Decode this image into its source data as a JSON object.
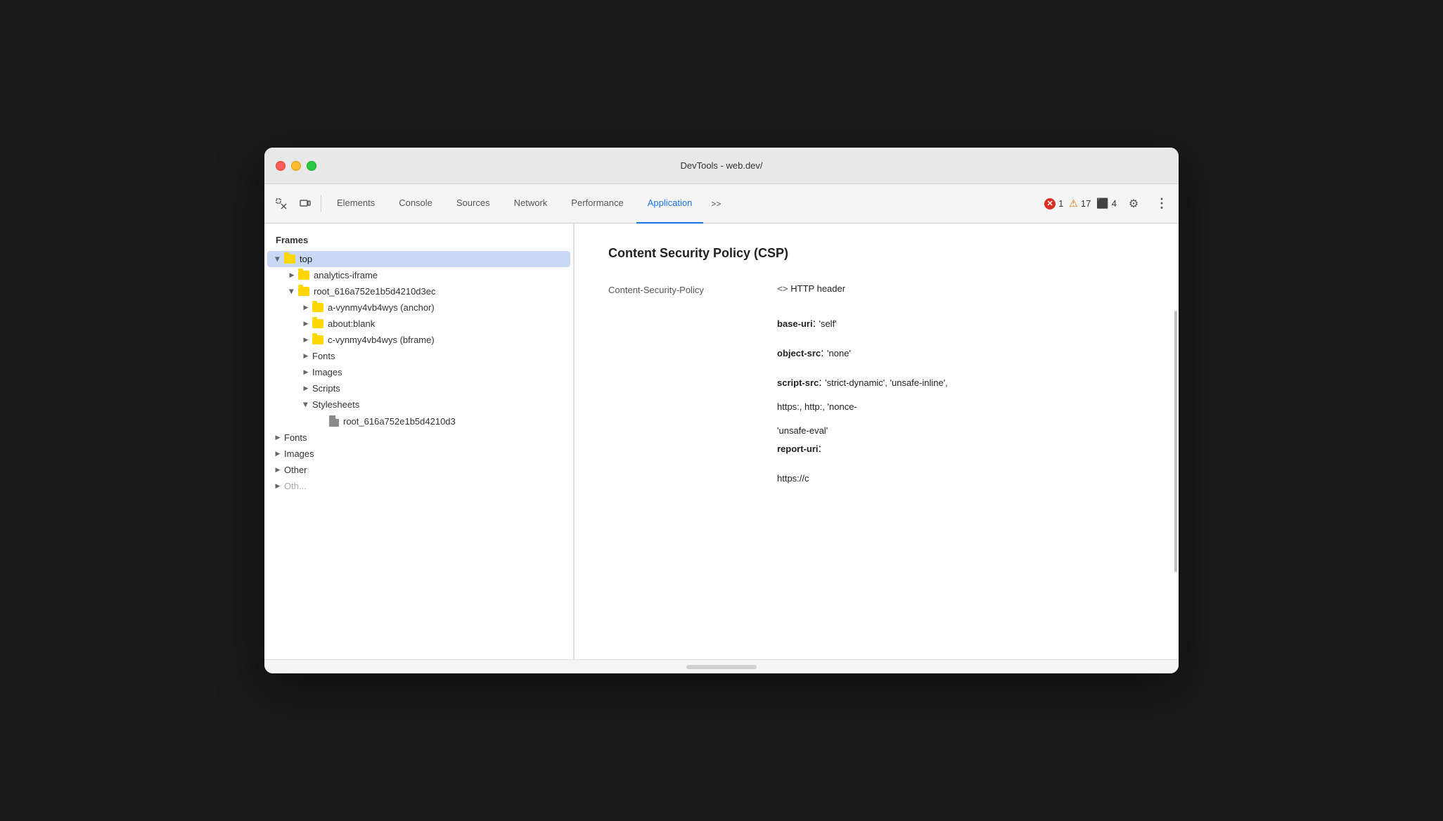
{
  "window": {
    "title": "DevTools - web.dev/"
  },
  "toolbar": {
    "tabs": [
      {
        "id": "elements",
        "label": "Elements",
        "active": false
      },
      {
        "id": "console",
        "label": "Console",
        "active": false
      },
      {
        "id": "sources",
        "label": "Sources",
        "active": false
      },
      {
        "id": "network",
        "label": "Network",
        "active": false
      },
      {
        "id": "performance",
        "label": "Performance",
        "active": false
      },
      {
        "id": "application",
        "label": "Application",
        "active": true
      }
    ],
    "errors_count": "1",
    "warnings_count": "17",
    "info_count": "4"
  },
  "sidebar": {
    "title": "Frames",
    "tree": [
      {
        "id": "top",
        "label": "top",
        "level": 0,
        "expanded": true,
        "type": "folder",
        "selected": false
      },
      {
        "id": "analytics-iframe",
        "label": "analytics-iframe",
        "level": 1,
        "expanded": false,
        "type": "folder",
        "selected": false
      },
      {
        "id": "root-frame",
        "label": "root_616a752e1b5d4210d3ec",
        "level": 1,
        "expanded": true,
        "type": "folder",
        "selected": false
      },
      {
        "id": "a-vynmy4vb4wys",
        "label": "a-vynmy4vb4wys (anchor)",
        "level": 2,
        "expanded": false,
        "type": "folder",
        "selected": false
      },
      {
        "id": "about-blank",
        "label": "about:blank",
        "level": 2,
        "expanded": false,
        "type": "folder",
        "selected": false
      },
      {
        "id": "c-vynmy4vb4wys",
        "label": "c-vynmy4vb4wys (bframe)",
        "level": 2,
        "expanded": false,
        "type": "folder",
        "selected": false
      },
      {
        "id": "fonts-sub",
        "label": "Fonts",
        "level": 2,
        "expanded": false,
        "type": "leaf",
        "selected": false
      },
      {
        "id": "images-sub",
        "label": "Images",
        "level": 2,
        "expanded": false,
        "type": "leaf",
        "selected": false
      },
      {
        "id": "scripts-sub",
        "label": "Scripts",
        "level": 2,
        "expanded": false,
        "type": "leaf",
        "selected": false
      },
      {
        "id": "stylesheets-sub",
        "label": "Stylesheets",
        "level": 2,
        "expanded": true,
        "type": "leaf-expanded",
        "selected": false
      },
      {
        "id": "stylesheet-file",
        "label": "root_616a752e1b5d4210d3",
        "level": 3,
        "expanded": false,
        "type": "file",
        "selected": false
      },
      {
        "id": "fonts-top",
        "label": "Fonts",
        "level": 0,
        "expanded": false,
        "type": "leaf",
        "selected": false
      },
      {
        "id": "images-top",
        "label": "Images",
        "level": 0,
        "expanded": false,
        "type": "leaf",
        "selected": false
      },
      {
        "id": "other-top",
        "label": "Other",
        "level": 0,
        "expanded": false,
        "type": "leaf",
        "selected": false
      }
    ]
  },
  "main": {
    "csp_title": "Content Security Policy (CSP)",
    "label": "Content-Security-Policy",
    "header_type": "<> HTTP header",
    "directives": [
      {
        "name": "base-uri",
        "value": "'self'"
      },
      {
        "name": "object-src",
        "value": "'none'"
      },
      {
        "name": "script-src",
        "value": "'strict-dynamic', 'unsafe-inline',"
      },
      {
        "name": "",
        "value": "https:, http:, 'nonce-"
      },
      {
        "name": "",
        "value": ""
      },
      {
        "name": "",
        "value": "'unsafe-eval'"
      },
      {
        "name": "report-uri",
        "value": ""
      },
      {
        "name": "",
        "value": "https://c"
      }
    ]
  },
  "icons": {
    "inspect": "⬚",
    "device": "▭",
    "more": ">>",
    "gear": "⚙",
    "menu": "⋮",
    "arrow_right": "▶",
    "folder": "📁",
    "file": "📄"
  }
}
